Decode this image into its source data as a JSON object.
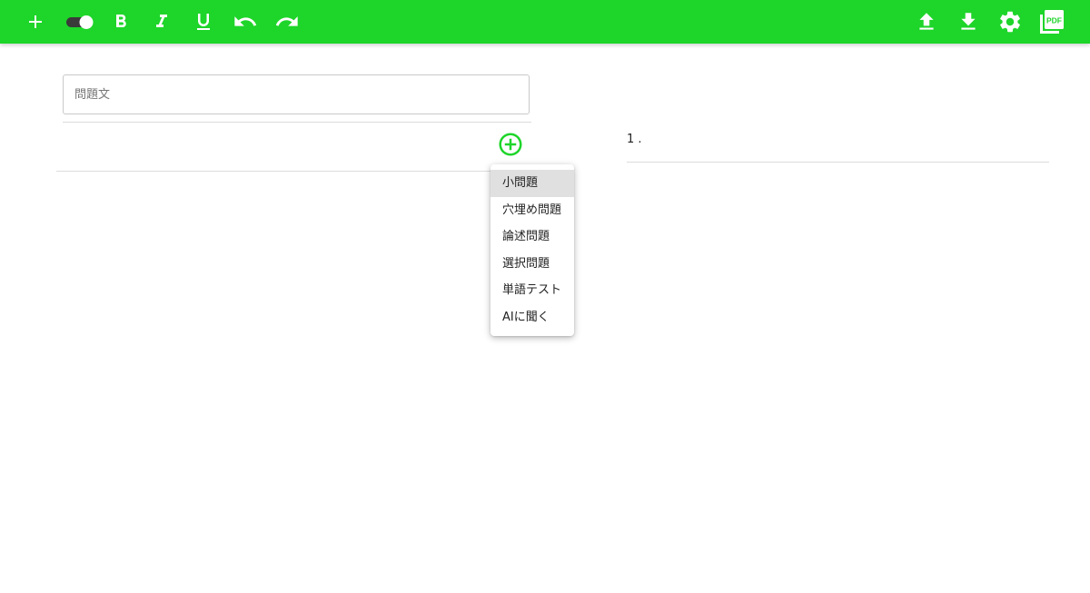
{
  "toolbar": {
    "background": "#1ed52a",
    "left_buttons": [
      {
        "name": "add-button",
        "icon": "plus-icon"
      },
      {
        "name": "toggle-switch",
        "icon": "toggle-icon"
      },
      {
        "name": "bold-button",
        "icon": "bold-icon"
      },
      {
        "name": "italic-button",
        "icon": "italic-icon"
      },
      {
        "name": "underline-button",
        "icon": "underline-icon"
      },
      {
        "name": "undo-button",
        "icon": "undo-icon"
      },
      {
        "name": "redo-button",
        "icon": "redo-icon"
      }
    ],
    "right_buttons": [
      {
        "name": "upload-button",
        "icon": "upload-icon"
      },
      {
        "name": "download-button",
        "icon": "download-icon"
      },
      {
        "name": "settings-button",
        "icon": "gear-icon"
      },
      {
        "name": "pdf-button",
        "icon": "pdf-icon",
        "label": "PDF"
      }
    ]
  },
  "editor": {
    "question_placeholder": "問題文",
    "question_value": "",
    "add_icon": "plus-circle-icon",
    "accent": "#1ed52a"
  },
  "menu": {
    "items": [
      {
        "label": "小問題",
        "active": true
      },
      {
        "label": "穴埋め問題",
        "active": false
      },
      {
        "label": "論述問題",
        "active": false
      },
      {
        "label": "選択問題",
        "active": false
      },
      {
        "label": "単語テスト",
        "active": false
      },
      {
        "label": "AIに聞く",
        "active": false
      }
    ]
  },
  "preview": {
    "item_number": "1 ."
  }
}
